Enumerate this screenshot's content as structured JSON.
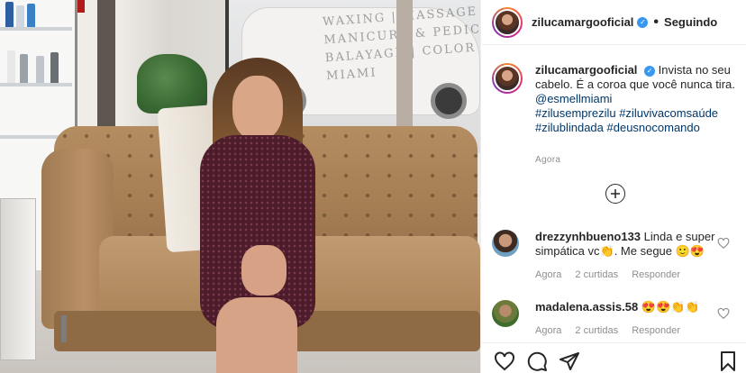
{
  "post": {
    "username": "zilucamargooficial",
    "separator": "•",
    "follow_status": "Seguindo"
  },
  "caption": {
    "username": "zilucamargooficial",
    "text": "Invista no seu cabelo. É a coroa que você nunca tira.",
    "mention": "@esmellmiami",
    "hashtags_line1": "#zilusemprezilu #ziluvivacomsaúde",
    "hashtags_line2": "#zilublindada #deusnocomando",
    "time": "Agora"
  },
  "comments": [
    {
      "username": "drezzynhbueno133",
      "text": "Linda e super simpática vc👏. Me segue 🙂😍",
      "time": "Agora",
      "likes": "2 curtidas",
      "reply": "Responder"
    },
    {
      "username": "madalena.assis.58",
      "text": "😍😍👏👏",
      "time": "Agora",
      "likes": "2 curtidas",
      "reply": "Responder"
    }
  ],
  "photo_sign": "WAXING | MASSAGE\nMANICURE & PEDICURE\nBALAYAGE | COLOR\nMIAMI",
  "icons": {
    "verified": "verified-badge-icon",
    "load_more": "plus-circle-icon",
    "heart": "heart-outline-icon",
    "comment": "comment-bubble-icon",
    "share": "paper-plane-icon",
    "save": "bookmark-icon"
  },
  "colors": {
    "link": "#00376b",
    "verified": "#3897f0",
    "muted": "#8e8e8e",
    "text": "#262626"
  }
}
